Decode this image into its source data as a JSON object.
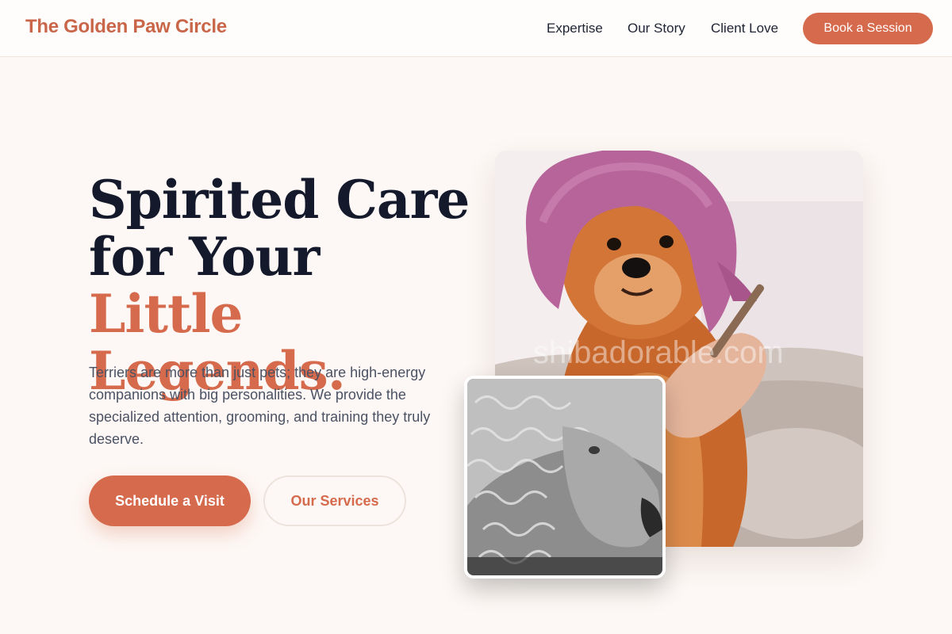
{
  "header": {
    "brand": "The Golden Paw Circle",
    "nav": [
      "Expertise",
      "Our Story",
      "Client Love"
    ],
    "cta": "Book a Session"
  },
  "hero": {
    "title_line1": "Spirited Care",
    "title_line2_plain": "for Your ",
    "title_line2_accent": "Little",
    "title_line3_accent": "Legends.",
    "description": "Terriers are more than just pets; they are high-energy companions with big personalities. We provide the specialized attention, grooming, and training they truly deserve.",
    "primary_button": "Schedule a Visit",
    "secondary_button": "Our Services"
  },
  "images": {
    "main_photo_icon": "dog-in-towel-photo",
    "inset_photo_icon": "sheep-bw-photo",
    "watermark": "shibadorable.com"
  },
  "colors": {
    "accent": "#d66a4c",
    "brand": "#c9664a",
    "heading": "#141a2b",
    "background": "#fdf8f5"
  }
}
